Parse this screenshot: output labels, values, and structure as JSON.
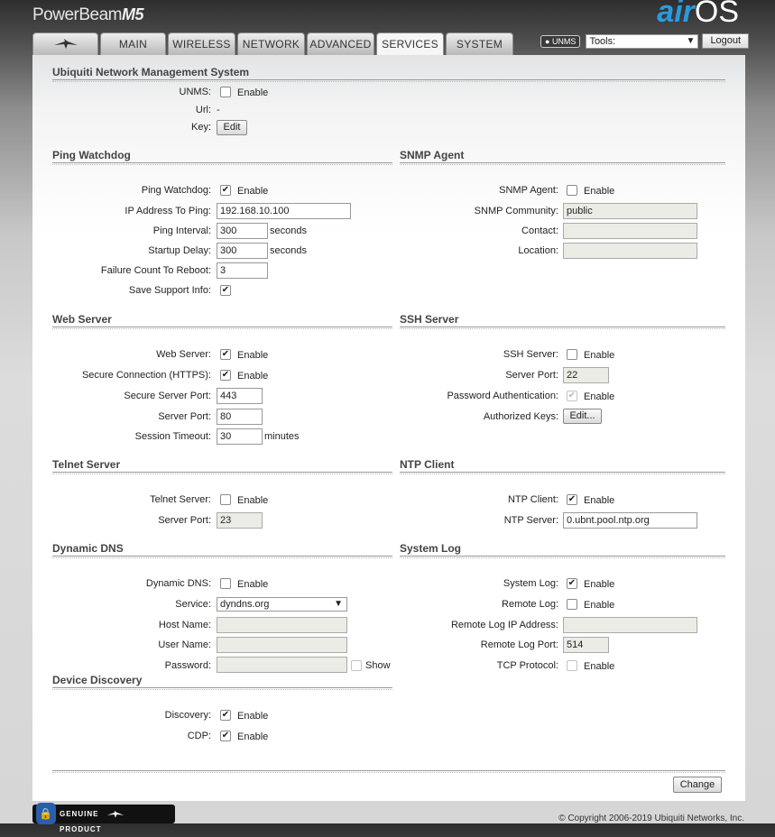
{
  "header": {
    "brand": "PowerBeam",
    "brand_model": "M5",
    "logo_air": "air",
    "logo_os": "OS"
  },
  "tabs": [
    {
      "label": "",
      "icon": "ubiquiti-logo-icon"
    },
    {
      "label": "MAIN"
    },
    {
      "label": "WIRELESS"
    },
    {
      "label": "NETWORK"
    },
    {
      "label": "ADVANCED"
    },
    {
      "label": "SERVICES",
      "active": true
    },
    {
      "label": "SYSTEM"
    }
  ],
  "top_tools": {
    "unms_badge": "UNMS",
    "tools_value": "Tools:",
    "logout_label": "Logout"
  },
  "unms": {
    "title": "Ubiquiti Network Management System",
    "unms_label": "UNMS:",
    "enable": "Enable",
    "url_label": "Url:",
    "url_value": "-",
    "key_label": "Key:",
    "edit_label": "Edit"
  },
  "ping": {
    "title": "Ping Watchdog",
    "watchdog_label": "Ping Watchdog:",
    "enable": "Enable",
    "ip_label": "IP Address To Ping:",
    "ip_value": "192.168.10.100",
    "interval_label": "Ping Interval:",
    "interval_value": "300",
    "delay_label": "Startup Delay:",
    "delay_value": "300",
    "seconds": "seconds",
    "failure_label": "Failure Count To Reboot:",
    "failure_value": "3",
    "support_label": "Save Support Info:"
  },
  "snmp": {
    "title": "SNMP Agent",
    "agent_label": "SNMP Agent:",
    "enable": "Enable",
    "community_label": "SNMP Community:",
    "community_value": "public",
    "contact_label": "Contact:",
    "contact_value": "",
    "location_label": "Location:",
    "location_value": ""
  },
  "web": {
    "title": "Web Server",
    "server_label": "Web Server:",
    "enable": "Enable",
    "https_label": "Secure Connection (HTTPS):",
    "secure_port_label": "Secure Server Port:",
    "secure_port_value": "443",
    "port_label": "Server Port:",
    "port_value": "80",
    "timeout_label": "Session Timeout:",
    "timeout_value": "30",
    "minutes": "minutes"
  },
  "ssh": {
    "title": "SSH Server",
    "server_label": "SSH Server:",
    "enable": "Enable",
    "port_label": "Server Port:",
    "port_value": "22",
    "pw_label": "Password Authentication:",
    "keys_label": "Authorized Keys:",
    "edit_label": "Edit..."
  },
  "telnet": {
    "title": "Telnet Server",
    "server_label": "Telnet Server:",
    "enable": "Enable",
    "port_label": "Server Port:",
    "port_value": "23"
  },
  "ntp": {
    "title": "NTP Client",
    "client_label": "NTP Client:",
    "enable": "Enable",
    "server_label": "NTP Server:",
    "server_value": "0.ubnt.pool.ntp.org"
  },
  "ddns": {
    "title": "Dynamic DNS",
    "ddns_label": "Dynamic DNS:",
    "enable": "Enable",
    "service_label": "Service:",
    "service_value": "dyndns.org",
    "host_label": "Host Name:",
    "host_value": "",
    "user_label": "User Name:",
    "user_value": "",
    "password_label": "Password:",
    "password_value": "",
    "show": "Show"
  },
  "syslog": {
    "title": "System Log",
    "log_label": "System Log:",
    "enable": "Enable",
    "remote_label": "Remote Log:",
    "remote_ip_label": "Remote Log IP Address:",
    "remote_ip_value": "",
    "remote_port_label": "Remote Log Port:",
    "remote_port_value": "514",
    "tcp_label": "TCP Protocol:"
  },
  "discovery": {
    "title": "Device Discovery",
    "discovery_label": "Discovery:",
    "enable": "Enable",
    "cdp_label": "CDP:"
  },
  "footer": {
    "change_label": "Change",
    "genuine_left": "GENUINE",
    "genuine_right": "PRODUCT",
    "copyright": "© Copyright 2006-2019 Ubiquiti Networks, Inc."
  },
  "check_glyph": "✔"
}
